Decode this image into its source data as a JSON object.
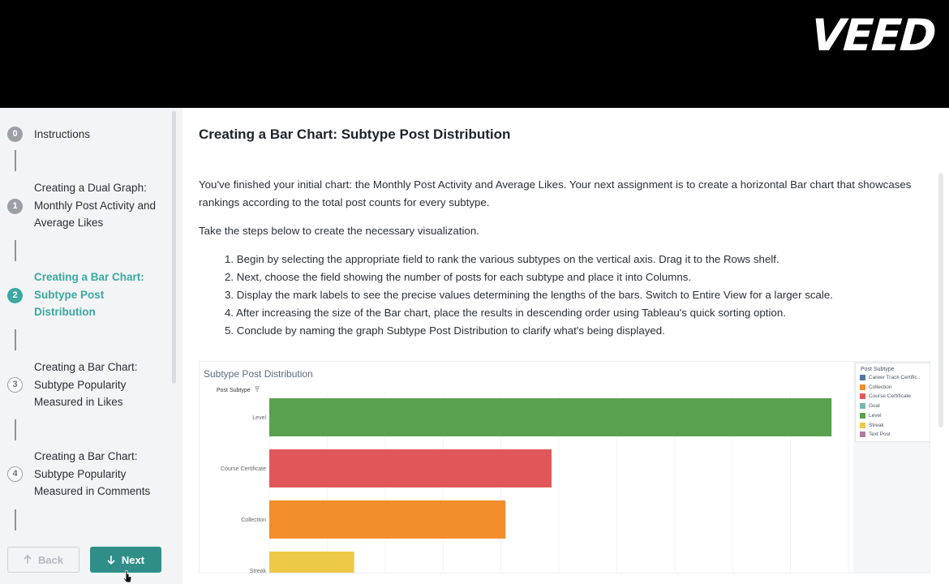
{
  "brand": {
    "logo_text": "VEED"
  },
  "sidebar": {
    "steps": [
      {
        "num": "0",
        "label": "Instructions",
        "state": "done"
      },
      {
        "num": "1",
        "label": "Creating a Dual Graph: Monthly Post Activity and Average Likes",
        "state": "done"
      },
      {
        "num": "2",
        "label": "Creating a Bar Chart: Subtype Post Distribution",
        "state": "active"
      },
      {
        "num": "3",
        "label": "Creating a Bar Chart: Subtype Popularity Measured in Likes",
        "state": "upcoming"
      },
      {
        "num": "4",
        "label": "Creating a Bar Chart: Subtype Popularity Measured in Comments",
        "state": "upcoming"
      }
    ],
    "back_label": "Back",
    "next_label": "Next"
  },
  "main": {
    "title": "Creating a Bar Chart: Subtype Post Distribution",
    "intro": "You've finished your initial chart: the Monthly Post Activity and Average Likes. Your next assignment is to create a horizontal Bar chart that showcases rankings according to the total post counts for every subtype.",
    "lead": "Take the steps below to create the necessary visualization.",
    "steps": [
      "1. Begin by selecting the appropriate field to rank the various subtypes on the vertical axis. Drag it to the Rows shelf.",
      "2. Next, choose the field showing the number of posts for each subtype and place it into Columns.",
      "3. Display the mark labels to see the precise values determining the lengths of the bars. Switch to Entire View for a larger scale.",
      "4. After increasing the size of the Bar chart, place the results in descending order using Tableau's quick sorting option.",
      "5. Conclude by naming the graph Subtype Post Distribution to clarify what's being displayed."
    ]
  },
  "viz": {
    "title": "Subtype Post Distribution",
    "row_header": "Post Subtype",
    "legend_title": "Post Subtype",
    "legend": [
      {
        "label": "Career Track Certific..",
        "color": "#4e79a7"
      },
      {
        "label": "Collection",
        "color": "#f28e2b"
      },
      {
        "label": "Course Certificate",
        "color": "#e15759"
      },
      {
        "label": "Goal",
        "color": "#76b7b2"
      },
      {
        "label": "Level",
        "color": "#59a14f"
      },
      {
        "label": "Streak",
        "color": "#edc948"
      },
      {
        "label": "Text Post",
        "color": "#b07aa1"
      }
    ]
  },
  "chart_data": {
    "type": "bar",
    "orientation": "horizontal",
    "title": "Subtype Post Distribution",
    "categories": [
      "Level",
      "Course Certificate",
      "Collection",
      "Streak"
    ],
    "values": [
      100,
      50.2,
      42,
      15.1
    ],
    "colors": [
      "#59a14f",
      "#e15759",
      "#f28e2b",
      "#edc948"
    ],
    "xlim": [
      0,
      103
    ],
    "grid": true,
    "legend_position": "right"
  }
}
